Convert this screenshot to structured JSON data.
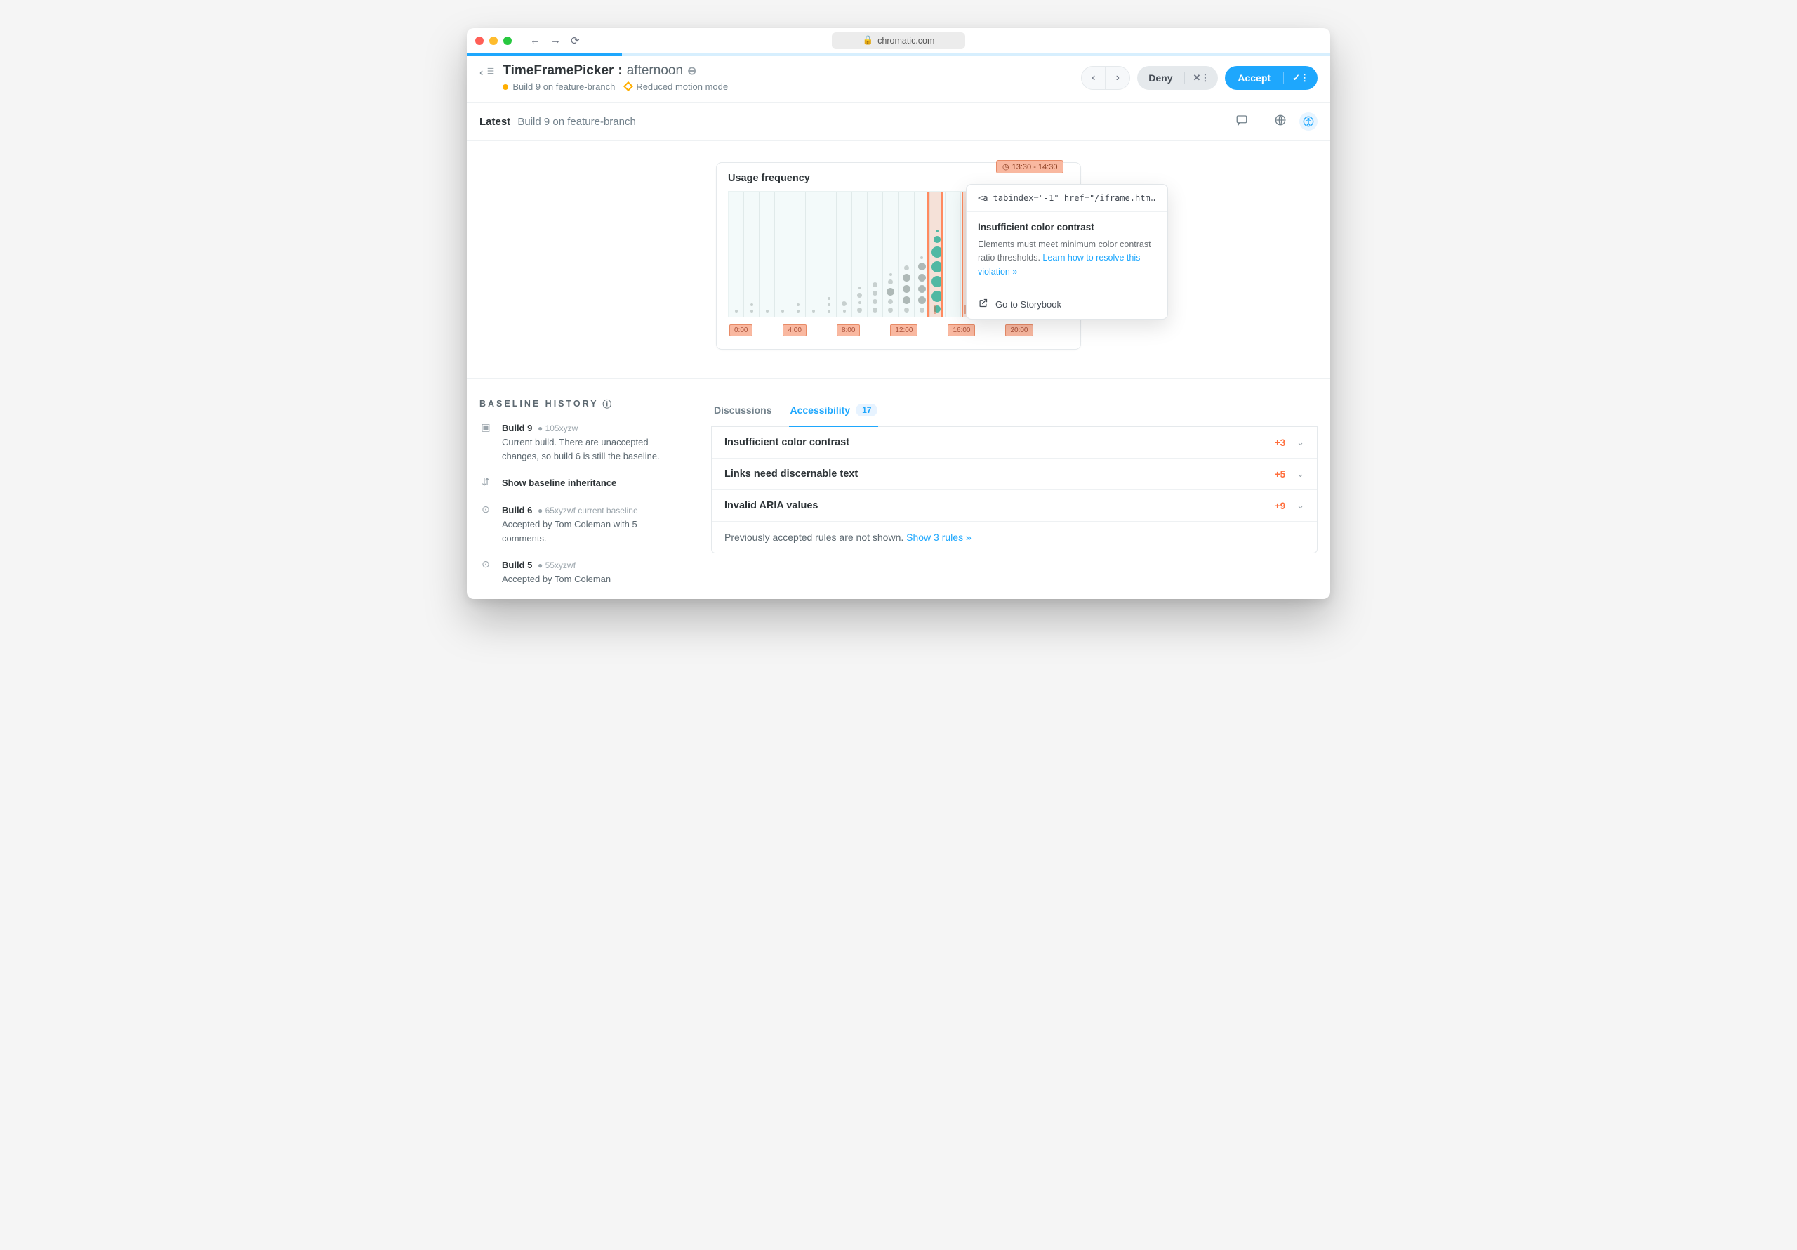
{
  "browser": {
    "url": "chromatic.com"
  },
  "header": {
    "component": "TimeFramePicker",
    "sep": " : ",
    "story": "afternoon",
    "build_line": "Build 9 on feature-branch",
    "mode": "Reduced motion mode",
    "deny": "Deny",
    "accept": "Accept"
  },
  "subhead": {
    "latest": "Latest",
    "build": "Build 9 on feature-branch"
  },
  "chart": {
    "title": "Usage frequency",
    "time_chip": "13:30 - 14:30",
    "axis": [
      "0:00",
      "4:00",
      "8:00",
      "12:00",
      "16:00",
      "20:00"
    ]
  },
  "popover": {
    "code": "<a tabindex=\"-1\" href=\"/iframe.htm...",
    "title": "Insufficient color contrast",
    "desc": "Elements must meet minimum color contrast ratio thresholds. ",
    "link": "Learn how to resolve this violation »",
    "foot": "Go to Storybook"
  },
  "baseline": {
    "title": "BASELINE HISTORY",
    "items": [
      {
        "name": "Build 9",
        "hash": "105xyzw",
        "desc": "Current build. There are unaccepted changes, so build 6 is still the baseline."
      },
      {
        "name": "Show baseline inheritance",
        "hash": "",
        "desc": ""
      },
      {
        "name": "Build 6",
        "hash": "65xyzwf current baseline",
        "desc": "Accepted by Tom Coleman with 5 comments."
      },
      {
        "name": "Build 5",
        "hash": "55xyzwf",
        "desc": "Accepted by Tom Coleman"
      }
    ]
  },
  "tabs": {
    "discussions": "Discussions",
    "accessibility": "Accessibility",
    "count": "17"
  },
  "violations": [
    {
      "label": "Insufficient color contrast",
      "count": "+3"
    },
    {
      "label": "Links need discernable text",
      "count": "+5"
    },
    {
      "label": "Invalid ARIA values",
      "count": "+9"
    }
  ],
  "prev": {
    "text": "Previously accepted rules are not shown. ",
    "link": "Show 3  rules »"
  }
}
